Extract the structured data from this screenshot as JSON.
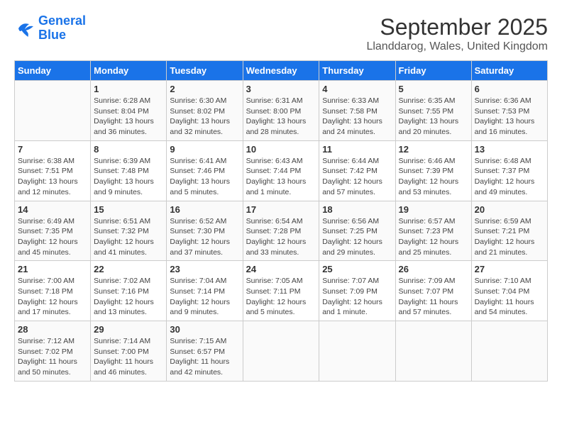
{
  "logo": {
    "line1": "General",
    "line2": "Blue"
  },
  "title": "September 2025",
  "subtitle": "Llanddarog, Wales, United Kingdom",
  "headers": [
    "Sunday",
    "Monday",
    "Tuesday",
    "Wednesday",
    "Thursday",
    "Friday",
    "Saturday"
  ],
  "weeks": [
    [
      {
        "day": "",
        "info": ""
      },
      {
        "day": "1",
        "info": "Sunrise: 6:28 AM\nSunset: 8:04 PM\nDaylight: 13 hours\nand 36 minutes."
      },
      {
        "day": "2",
        "info": "Sunrise: 6:30 AM\nSunset: 8:02 PM\nDaylight: 13 hours\nand 32 minutes."
      },
      {
        "day": "3",
        "info": "Sunrise: 6:31 AM\nSunset: 8:00 PM\nDaylight: 13 hours\nand 28 minutes."
      },
      {
        "day": "4",
        "info": "Sunrise: 6:33 AM\nSunset: 7:58 PM\nDaylight: 13 hours\nand 24 minutes."
      },
      {
        "day": "5",
        "info": "Sunrise: 6:35 AM\nSunset: 7:55 PM\nDaylight: 13 hours\nand 20 minutes."
      },
      {
        "day": "6",
        "info": "Sunrise: 6:36 AM\nSunset: 7:53 PM\nDaylight: 13 hours\nand 16 minutes."
      }
    ],
    [
      {
        "day": "7",
        "info": "Sunrise: 6:38 AM\nSunset: 7:51 PM\nDaylight: 13 hours\nand 12 minutes."
      },
      {
        "day": "8",
        "info": "Sunrise: 6:39 AM\nSunset: 7:48 PM\nDaylight: 13 hours\nand 9 minutes."
      },
      {
        "day": "9",
        "info": "Sunrise: 6:41 AM\nSunset: 7:46 PM\nDaylight: 13 hours\nand 5 minutes."
      },
      {
        "day": "10",
        "info": "Sunrise: 6:43 AM\nSunset: 7:44 PM\nDaylight: 13 hours\nand 1 minute."
      },
      {
        "day": "11",
        "info": "Sunrise: 6:44 AM\nSunset: 7:42 PM\nDaylight: 12 hours\nand 57 minutes."
      },
      {
        "day": "12",
        "info": "Sunrise: 6:46 AM\nSunset: 7:39 PM\nDaylight: 12 hours\nand 53 minutes."
      },
      {
        "day": "13",
        "info": "Sunrise: 6:48 AM\nSunset: 7:37 PM\nDaylight: 12 hours\nand 49 minutes."
      }
    ],
    [
      {
        "day": "14",
        "info": "Sunrise: 6:49 AM\nSunset: 7:35 PM\nDaylight: 12 hours\nand 45 minutes."
      },
      {
        "day": "15",
        "info": "Sunrise: 6:51 AM\nSunset: 7:32 PM\nDaylight: 12 hours\nand 41 minutes."
      },
      {
        "day": "16",
        "info": "Sunrise: 6:52 AM\nSunset: 7:30 PM\nDaylight: 12 hours\nand 37 minutes."
      },
      {
        "day": "17",
        "info": "Sunrise: 6:54 AM\nSunset: 7:28 PM\nDaylight: 12 hours\nand 33 minutes."
      },
      {
        "day": "18",
        "info": "Sunrise: 6:56 AM\nSunset: 7:25 PM\nDaylight: 12 hours\nand 29 minutes."
      },
      {
        "day": "19",
        "info": "Sunrise: 6:57 AM\nSunset: 7:23 PM\nDaylight: 12 hours\nand 25 minutes."
      },
      {
        "day": "20",
        "info": "Sunrise: 6:59 AM\nSunset: 7:21 PM\nDaylight: 12 hours\nand 21 minutes."
      }
    ],
    [
      {
        "day": "21",
        "info": "Sunrise: 7:00 AM\nSunset: 7:18 PM\nDaylight: 12 hours\nand 17 minutes."
      },
      {
        "day": "22",
        "info": "Sunrise: 7:02 AM\nSunset: 7:16 PM\nDaylight: 12 hours\nand 13 minutes."
      },
      {
        "day": "23",
        "info": "Sunrise: 7:04 AM\nSunset: 7:14 PM\nDaylight: 12 hours\nand 9 minutes."
      },
      {
        "day": "24",
        "info": "Sunrise: 7:05 AM\nSunset: 7:11 PM\nDaylight: 12 hours\nand 5 minutes."
      },
      {
        "day": "25",
        "info": "Sunrise: 7:07 AM\nSunset: 7:09 PM\nDaylight: 12 hours\nand 1 minute."
      },
      {
        "day": "26",
        "info": "Sunrise: 7:09 AM\nSunset: 7:07 PM\nDaylight: 11 hours\nand 57 minutes."
      },
      {
        "day": "27",
        "info": "Sunrise: 7:10 AM\nSunset: 7:04 PM\nDaylight: 11 hours\nand 54 minutes."
      }
    ],
    [
      {
        "day": "28",
        "info": "Sunrise: 7:12 AM\nSunset: 7:02 PM\nDaylight: 11 hours\nand 50 minutes."
      },
      {
        "day": "29",
        "info": "Sunrise: 7:14 AM\nSunset: 7:00 PM\nDaylight: 11 hours\nand 46 minutes."
      },
      {
        "day": "30",
        "info": "Sunrise: 7:15 AM\nSunset: 6:57 PM\nDaylight: 11 hours\nand 42 minutes."
      },
      {
        "day": "",
        "info": ""
      },
      {
        "day": "",
        "info": ""
      },
      {
        "day": "",
        "info": ""
      },
      {
        "day": "",
        "info": ""
      }
    ]
  ]
}
